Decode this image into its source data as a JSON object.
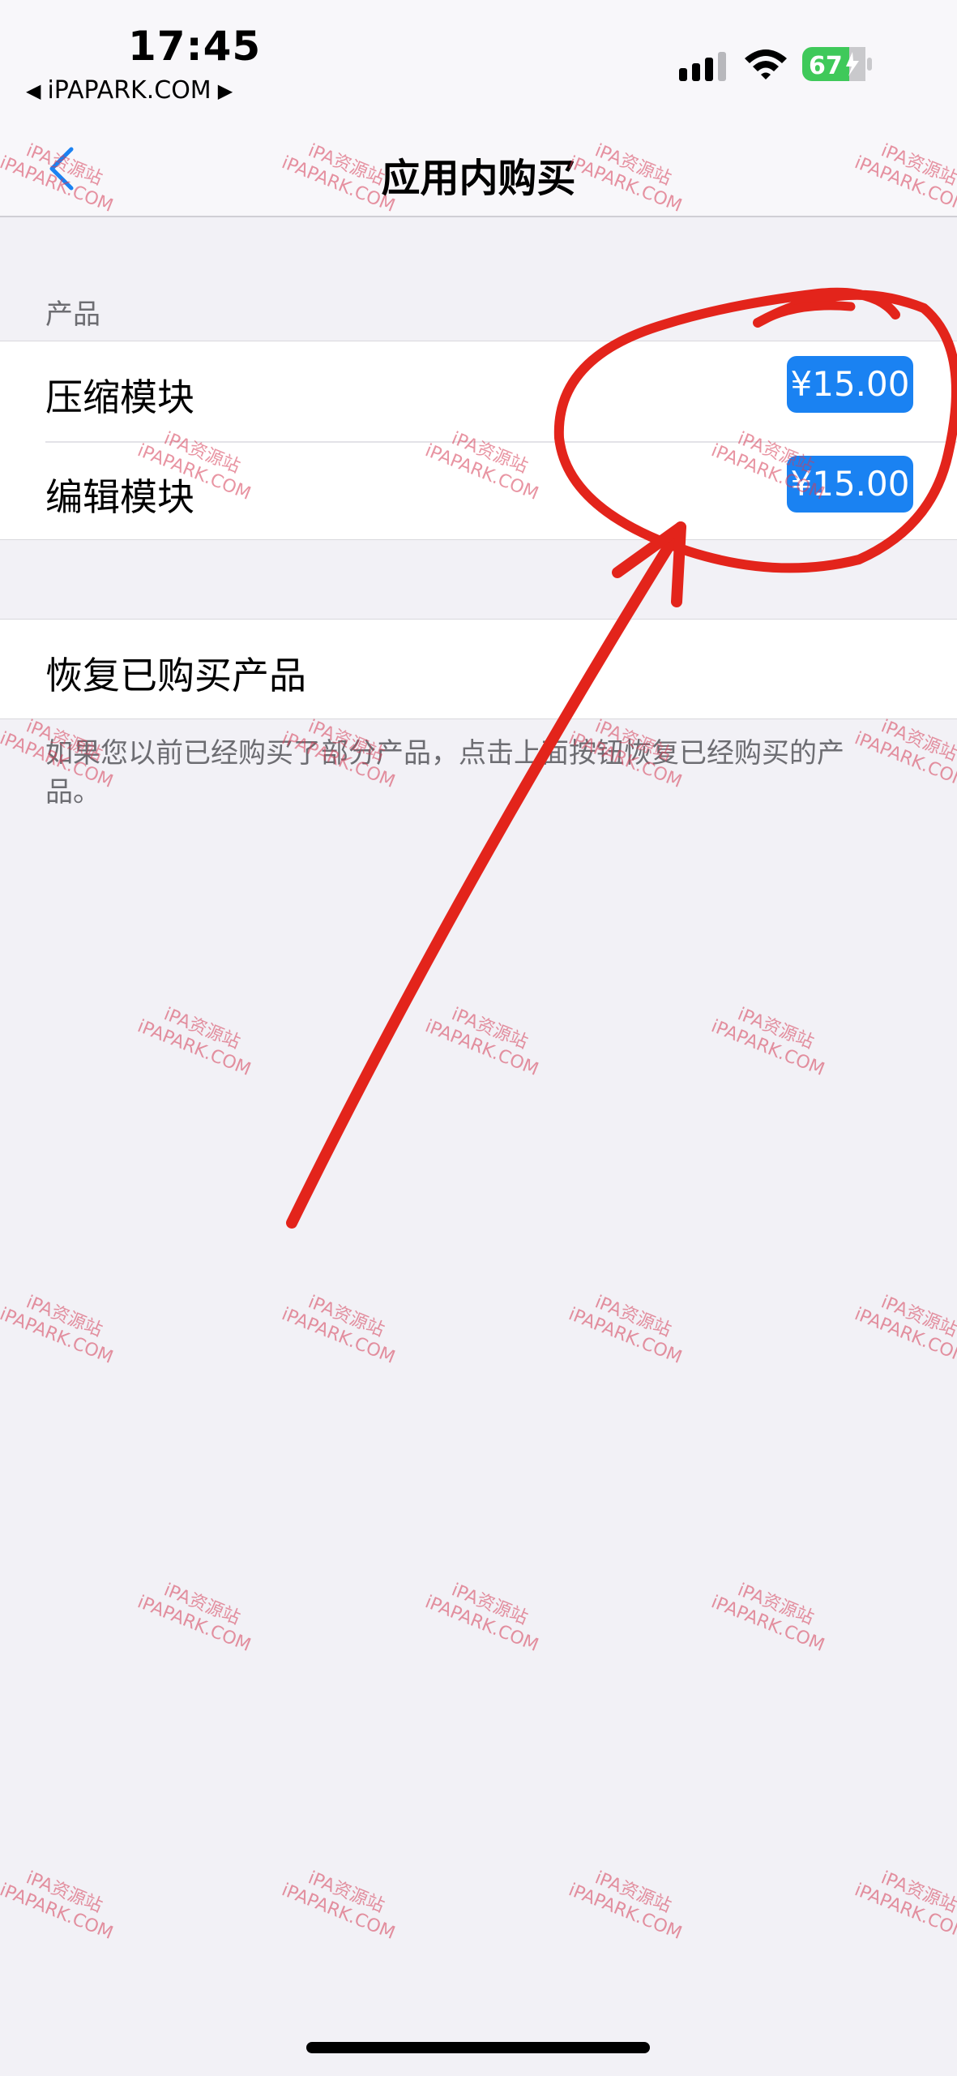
{
  "status_bar": {
    "time": "17:45",
    "back_to_app": "iPAPARK.COM",
    "battery_level": "67",
    "icons": [
      "cellular-signal-icon",
      "wifi-icon",
      "battery-charging-icon"
    ]
  },
  "nav": {
    "title": "应用内购买",
    "back_icon": "chevron-left-icon"
  },
  "products": {
    "header": "产品",
    "items": [
      {
        "label": "压缩模块",
        "price": "¥15.00"
      },
      {
        "label": "编辑模块",
        "price": "¥15.00"
      }
    ]
  },
  "restore": {
    "label": "恢复已购买产品",
    "note": "如果您以前已经购买了部分产品，点击上面按钮恢复已经购买的产品。"
  },
  "watermark": {
    "line1": "iPA资源站",
    "line2": "iPAPARK.COM"
  },
  "colors": {
    "accent": "#1a82f2",
    "background": "#f2f1f6",
    "annotation": "#e3241b",
    "watermark": "#d63c55"
  }
}
